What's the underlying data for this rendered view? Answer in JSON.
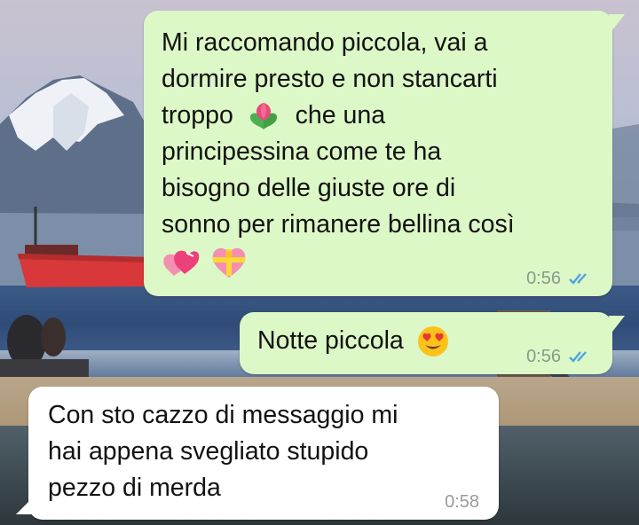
{
  "messages": [
    {
      "direction": "outgoing",
      "lines": [
        "Mi raccomando piccola, vai a",
        "dormire presto e non stancarti",
        "troppo",
        "che una",
        "principessina come te ha",
        "bisogno delle giuste ore di",
        "sonno per rimanere bellina così"
      ],
      "emojis": [
        "tulip-emoji",
        "heart-ribbon-emoji",
        "gift-heart-emoji"
      ],
      "time": "0:56",
      "status": "read"
    },
    {
      "direction": "outgoing",
      "text": "Notte piccola",
      "emojis": [
        "heart-eyes-emoji"
      ],
      "time": "0:56",
      "status": "read"
    },
    {
      "direction": "incoming",
      "lines": [
        "Con sto cazzo di messaggio mi",
        "hai appena svegliato stupido",
        "pezzo di merda"
      ],
      "time": "0:58"
    }
  ],
  "colors": {
    "outgoing_bubble": "#dcf8c6",
    "incoming_bubble": "#ffffff",
    "read_ticks": "#4fa3e0",
    "timestamp": "#8a9a8a"
  }
}
